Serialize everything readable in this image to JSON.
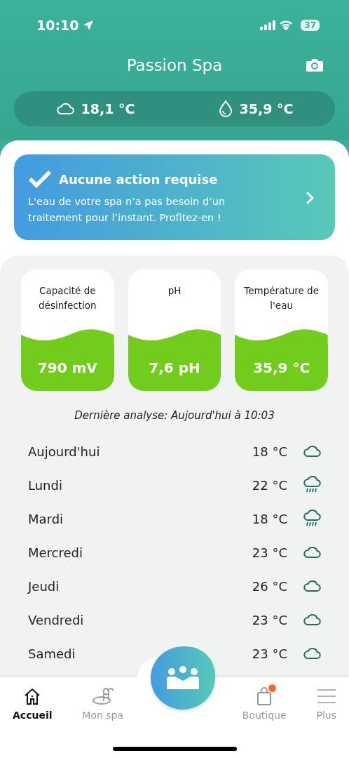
{
  "status_bar": {
    "time": "10:10",
    "battery": "37"
  },
  "header": {
    "title": "Passion Spa"
  },
  "readings": [
    {
      "kind": "air",
      "value": "18,1 °C"
    },
    {
      "kind": "water",
      "value": "35,9 °C"
    }
  ],
  "alert": {
    "title": "Aucune action requise",
    "message": "L'eau de votre spa n’a pas besoin d’un traitement pour l’instant. Profitez-en !"
  },
  "gauges": [
    {
      "label": "Capacité de désinfection",
      "value": "790 mV"
    },
    {
      "label": "pH",
      "value": "7,6 pH"
    },
    {
      "label": "Température de l'eau",
      "value": "35,9 °C"
    }
  ],
  "last_analysis": "Dernière analyse: Aujourd'hui à 10:03",
  "forecast": [
    {
      "day": "Aujourd'hui",
      "temp": "18 °C",
      "kind": "cloud"
    },
    {
      "day": "Lundi",
      "temp": "22 °C",
      "kind": "rain"
    },
    {
      "day": "Mardi",
      "temp": "18 °C",
      "kind": "rain"
    },
    {
      "day": "Mercredi",
      "temp": "23 °C",
      "kind": "cloud"
    },
    {
      "day": "Jeudi",
      "temp": "26 °C",
      "kind": "cloud"
    },
    {
      "day": "Vendredi",
      "temp": "23 °C",
      "kind": "cloud"
    },
    {
      "day": "Samedi",
      "temp": "23 °C",
      "kind": "cloud"
    }
  ],
  "tabs": [
    {
      "kind": "home",
      "label": "Accueil",
      "selected": true,
      "badge": false
    },
    {
      "kind": "spa",
      "label": "Mon spa",
      "selected": false,
      "badge": false
    },
    {
      "kind": "center",
      "selected": false,
      "badge": false
    },
    {
      "kind": "shop",
      "label": "Boutique",
      "selected": false,
      "badge": true
    },
    {
      "kind": "more",
      "label": "Plus",
      "selected": false,
      "badge": false
    }
  ]
}
